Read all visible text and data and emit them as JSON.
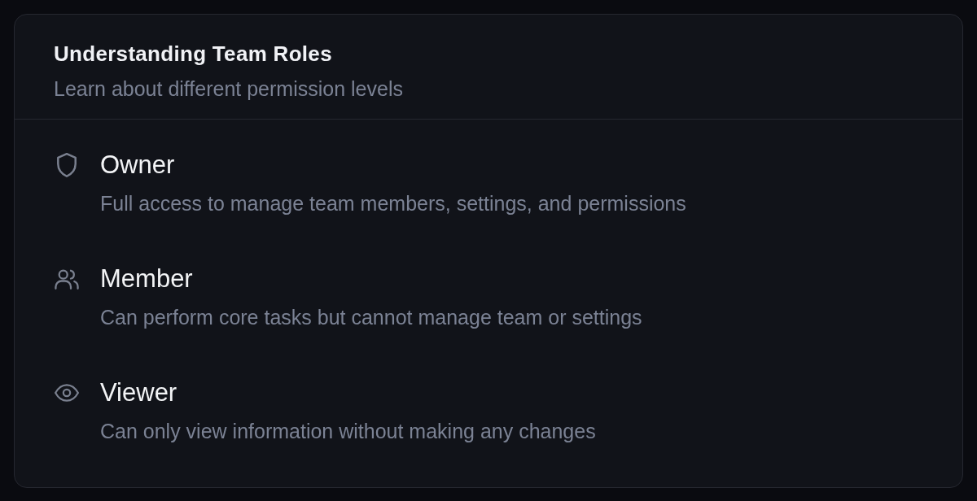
{
  "card": {
    "title": "Understanding Team Roles",
    "subtitle": "Learn about different permission levels"
  },
  "roles": [
    {
      "name": "Owner",
      "description": "Full access to manage team members, settings, and permissions"
    },
    {
      "name": "Member",
      "description": "Can perform core tasks but cannot manage team or settings"
    },
    {
      "name": "Viewer",
      "description": "Can only view information without making any changes"
    }
  ]
}
